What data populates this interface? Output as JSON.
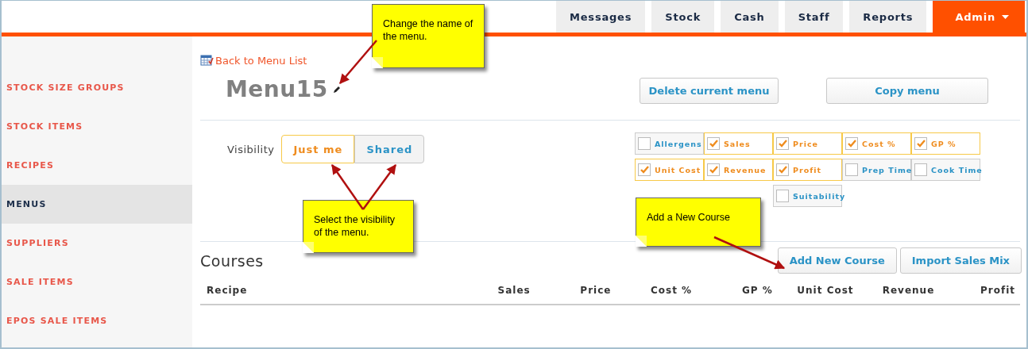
{
  "nav": {
    "tabs": [
      {
        "label": "Messages",
        "selected": false,
        "has_menu": false
      },
      {
        "label": "Stock",
        "selected": false,
        "has_menu": false
      },
      {
        "label": "Cash",
        "selected": false,
        "has_menu": false
      },
      {
        "label": "Staff",
        "selected": false,
        "has_menu": false
      },
      {
        "label": "Reports",
        "selected": false,
        "has_menu": false
      },
      {
        "label": "Admin",
        "selected": true,
        "has_menu": true
      }
    ]
  },
  "sidebar": {
    "items": [
      {
        "label": "STOCK SIZE GROUPS",
        "selected": false
      },
      {
        "label": "STOCK ITEMS",
        "selected": false
      },
      {
        "label": "RECIPES",
        "selected": false
      },
      {
        "label": "MENUS",
        "selected": true
      },
      {
        "label": "SUPPLIERS",
        "selected": false
      },
      {
        "label": "SALE ITEMS",
        "selected": false
      },
      {
        "label": "EPOS SALE ITEMS",
        "selected": false
      }
    ]
  },
  "back_link": "Back to Menu List",
  "menu_title": "Menu15",
  "menu_actions": [
    "Delete current menu",
    "Copy menu"
  ],
  "visibility": {
    "label": "Visibility",
    "options": [
      {
        "label": "Just me",
        "selected": true
      },
      {
        "label": "Shared",
        "selected": false
      }
    ]
  },
  "column_toggles": [
    {
      "label": "Allergens",
      "checked": false
    },
    {
      "label": "Sales",
      "checked": true
    },
    {
      "label": "Price",
      "checked": true
    },
    {
      "label": "Cost %",
      "checked": true
    },
    {
      "label": "GP %",
      "checked": true
    },
    {
      "label": "Unit Cost",
      "checked": true
    },
    {
      "label": "Revenue",
      "checked": true
    },
    {
      "label": "Profit",
      "checked": true
    },
    {
      "label": "Prep Time",
      "checked": false
    },
    {
      "label": "Cook Time",
      "checked": false
    },
    {
      "label": "Suitability",
      "checked": false
    }
  ],
  "courses": {
    "title": "Courses",
    "buttons": [
      "Add New Course",
      "Import Sales Mix"
    ],
    "columns": [
      "Recipe",
      "Sales",
      "Price",
      "Cost %",
      "GP %",
      "Unit Cost",
      "Revenue",
      "Profit"
    ]
  },
  "callouts": [
    {
      "text": "Change the name of the menu."
    },
    {
      "text": "Select the visibility of the menu."
    },
    {
      "text": "Add a New Course"
    }
  ]
}
